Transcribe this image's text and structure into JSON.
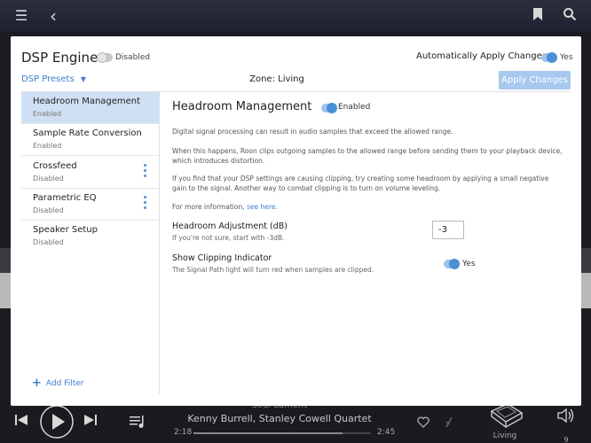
{
  "background": {
    "now_playing": {
      "title": "Soul Lament",
      "artist": "Kenny Burrell, Stanley Cowell Quartet",
      "elapsed": "2:18",
      "duration": "2:45",
      "progress": 0.84,
      "zone": "Living",
      "volume": "9"
    }
  },
  "modal": {
    "title": "DSP Engine",
    "engine_toggle_label": "Disabled",
    "auto_apply_label": "Automatically Apply Changes",
    "auto_apply_value": "Yes",
    "presets_label": "DSP Presets",
    "zone_label": "Zone: Living",
    "apply_button": "Apply Changes",
    "add_filter": "Add Filter"
  },
  "filters": [
    {
      "label": "Headroom Management",
      "status": "Enabled"
    },
    {
      "label": "Sample Rate Conversion",
      "status": "Enabled"
    },
    {
      "label": "Crossfeed",
      "status": "Disabled"
    },
    {
      "label": "Parametric EQ",
      "status": "Disabled"
    },
    {
      "label": "Speaker Setup",
      "status": "Disabled"
    }
  ],
  "detail": {
    "title": "Headroom Management",
    "toggle_label": "Enabled",
    "para1": "Digital signal processing can result in audio samples that exceed the allowed range.",
    "para2": "When this happens, Roon clips outgoing samples to the allowed range before sending them to your playback device, which introduces distortion.",
    "para3": "If you find that your DSP settings are causing clipping, try creating some headroom by applying a small negative gain to the signal. Another way to combat clipping is to turn on volume leveling.",
    "para4_prefix": "For more information, ",
    "para4_link": "see here",
    "para4_suffix": ".",
    "adjust_label": "Headroom Adjustment (dB)",
    "adjust_hint": "If you're not sure, start with -3dB.",
    "adjust_value": "-3",
    "clip_label": "Show Clipping Indicator",
    "clip_hint": "The Signal Path light will turn red when samples are clipped.",
    "clip_value": "Yes"
  },
  "colors": {
    "accent": "#4a90d9",
    "active_row": "#cfe0f5",
    "apply_disabled": "#a9c8ef"
  }
}
